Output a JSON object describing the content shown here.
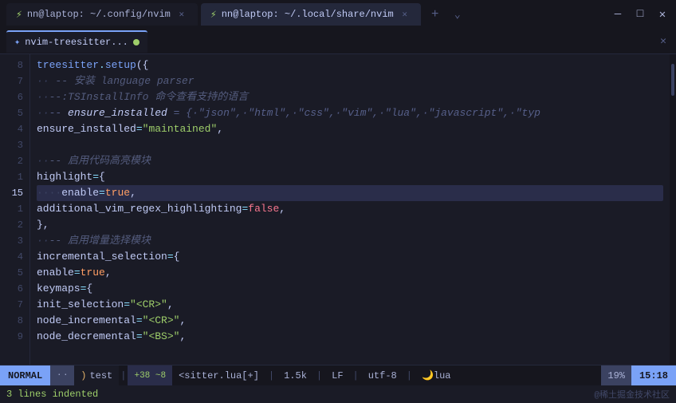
{
  "titlebar": {
    "tab1": {
      "label": "nn@laptop: ~/.config/nvim",
      "active": false
    },
    "tab2": {
      "label": "nn@laptop: ~/.local/share/nvim",
      "active": true
    },
    "new_tab_label": "+",
    "arrow_label": "⌄"
  },
  "file_tab": {
    "name": "nvim-treesitter...",
    "dot_color": "#9ece6a",
    "close": "✕"
  },
  "code_lines": [
    {
      "num": "8",
      "content": "treesitter.setup({",
      "type": "normal"
    },
    {
      "num": "7",
      "content": "  -- 安装 language parser",
      "type": "comment-zh"
    },
    {
      "num": "6",
      "content": "  --:TSInstallInfo 命令查看支持的语言",
      "type": "comment-zh"
    },
    {
      "num": "5",
      "content": "  --  ensure_installed = {·\"json\",·\"html\",·\"css\",·\"vim\",·\"lua\",·\"javascript\",·\"typ",
      "type": "comment"
    },
    {
      "num": "4",
      "content": "  ensure_installed = \"maintained\",",
      "type": "normal"
    },
    {
      "num": "3",
      "content": "",
      "type": "empty"
    },
    {
      "num": "2",
      "content": "  -- 启用代码高亮模块",
      "type": "comment-zh"
    },
    {
      "num": "1",
      "content": "  highlight = {",
      "type": "normal"
    },
    {
      "num": "15",
      "content": "    enable = true,",
      "type": "highlighted"
    },
    {
      "num": "1",
      "content": "    additional_vim_regex_highlighting = false,",
      "type": "normal"
    },
    {
      "num": "2",
      "content": "  },",
      "type": "normal"
    },
    {
      "num": "3",
      "content": "  -- 启用增量选择模块",
      "type": "comment-zh"
    },
    {
      "num": "4",
      "content": "  incremental_selection = {",
      "type": "normal"
    },
    {
      "num": "5",
      "content": "    enable = true,",
      "type": "normal"
    },
    {
      "num": "6",
      "content": "    keymaps = {",
      "type": "normal"
    },
    {
      "num": "7",
      "content": "      init_selection = \"<CR>\",",
      "type": "normal"
    },
    {
      "num": "8",
      "content": "      node_incremental = \"<CR>\",",
      "type": "normal"
    },
    {
      "num": "9",
      "content": "      node_decremental = \"<BS>\",",
      "type": "normal"
    }
  ],
  "statusbar": {
    "mode": "NORMAL",
    "dots": "··",
    "branch_icon": ")",
    "branch": "test",
    "diff": "+38 ~8",
    "filename": "<sitter.lua[+]",
    "filesize": "1.5k",
    "sep1": "|",
    "line_ending": "LF",
    "sep2": "|",
    "encoding": "utf-8",
    "sep3": "|",
    "filetype_icon": "🌙",
    "filetype": "lua",
    "percent": "19%",
    "position": "15:18"
  },
  "notify": {
    "message": "3 lines indented",
    "watermark": "@稀土掘金技术社区"
  }
}
